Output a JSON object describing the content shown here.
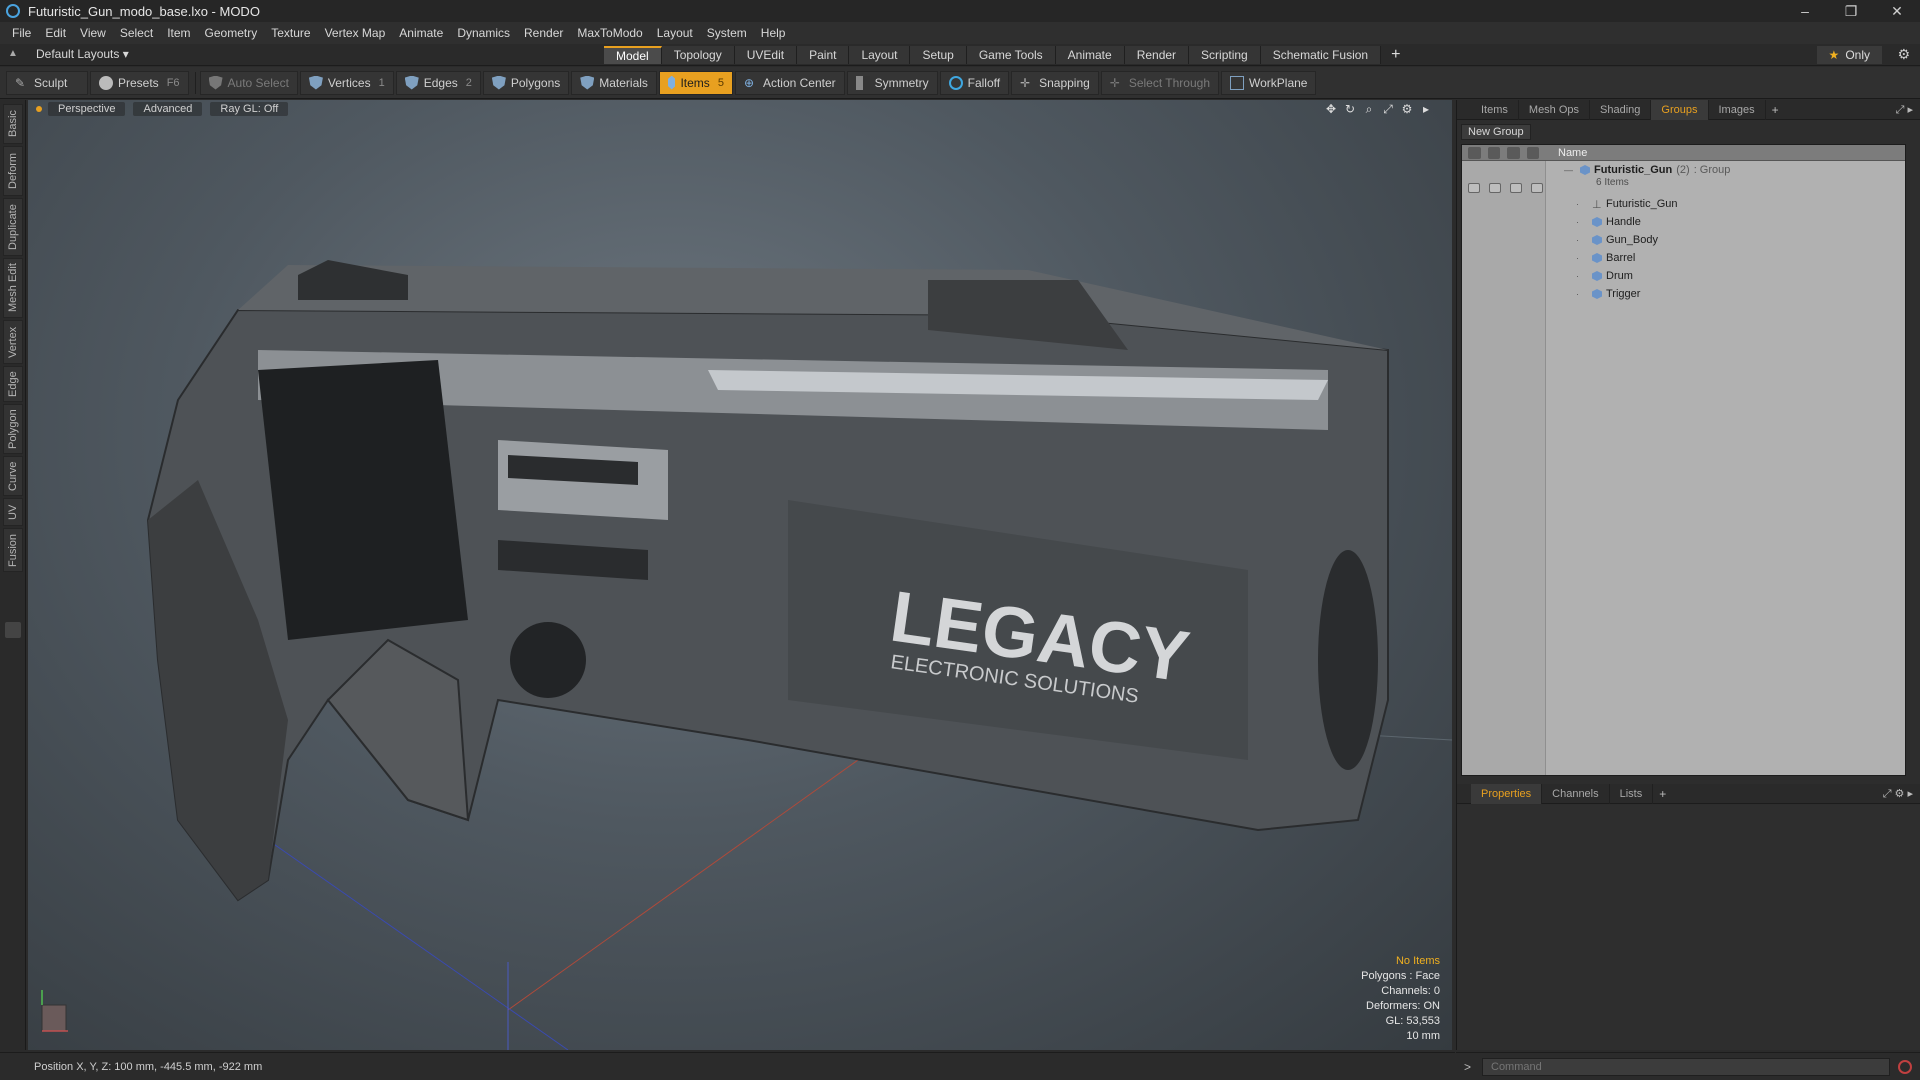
{
  "window": {
    "title": "Futuristic_Gun_modo_base.lxo - MODO",
    "controls": [
      "–",
      "❐",
      "✕"
    ]
  },
  "menu": [
    "File",
    "Edit",
    "View",
    "Select",
    "Item",
    "Geometry",
    "Texture",
    "Vertex Map",
    "Animate",
    "Dynamics",
    "Render",
    "MaxToModo",
    "Layout",
    "System",
    "Help"
  ],
  "layout_dropdown": "Default Layouts ▾",
  "tabs": [
    "Model",
    "Topology",
    "UVEdit",
    "Paint",
    "Layout",
    "Setup",
    "Game Tools",
    "Animate",
    "Render",
    "Scripting",
    "Schematic Fusion"
  ],
  "active_tab": "Model",
  "only_label": "Only",
  "toolbar": {
    "sculpt": "Sculpt",
    "presets": "Presets",
    "presets_key": "F6",
    "auto_select": "Auto Select",
    "vertices": "Vertices",
    "vertices_key": "1",
    "edges": "Edges",
    "edges_key": "2",
    "polygons": "Polygons",
    "materials": "Materials",
    "items": "Items",
    "items_key": "5",
    "action_center": "Action Center",
    "symmetry": "Symmetry",
    "falloff": "Falloff",
    "snapping": "Snapping",
    "select_through": "Select Through",
    "workplane": "WorkPlane"
  },
  "left_tabs": [
    "Basic",
    "Deform",
    "Duplicate",
    "Mesh Edit",
    "Vertex",
    "Edge",
    "Polygon",
    "Curve",
    "UV",
    "Fusion"
  ],
  "viewport": {
    "view": "Perspective",
    "shading": "Advanced",
    "raygl": "Ray GL: Off",
    "logo_main": "LEGACY",
    "logo_sub": "ELECTRONIC SOLUTIONS",
    "info": {
      "selection": "No Items",
      "polygons": "Polygons : Face",
      "channels": "Channels: 0",
      "deformers": "Deformers: ON",
      "gl": "GL: 53,553",
      "scale": "10 mm"
    }
  },
  "status": "Position X, Y, Z:  100 mm, -445.5 mm, -922 mm",
  "right_panel": {
    "tabs": [
      "Items",
      "Mesh Ops",
      "Shading",
      "Groups",
      "Images"
    ],
    "active_tab": "Groups",
    "new_group": "New Group",
    "column_name": "Name",
    "group": {
      "name": "Futuristic_Gun",
      "count": "(2)",
      "type": ": Group",
      "items_label": "6 Items"
    },
    "children": [
      "Futuristic_Gun",
      "Handle",
      "Gun_Body",
      "Barrel",
      "Drum",
      "Trigger"
    ],
    "props_tabs": [
      "Properties",
      "Channels",
      "Lists"
    ],
    "props_active": "Properties",
    "command_placeholder": "Command"
  }
}
